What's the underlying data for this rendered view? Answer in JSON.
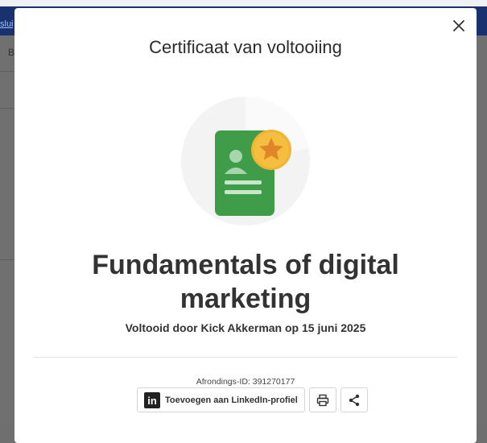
{
  "background": {
    "link_fragment": "slui"
  },
  "modal": {
    "title": "Certificaat van voltooiing",
    "course_title": "Fundamentals of digital marketing",
    "completed_text": "Voltooid door Kick Akkerman op 15 juni 2025",
    "completion_id_text": "Afrondings-ID: 391270177",
    "actions": {
      "linkedin_label": "Toevoegen aan LinkedIn-profiel"
    },
    "icons": {
      "close": "close-icon",
      "badge": "certificate-badge-icon",
      "linkedin": "linkedin-icon",
      "print": "print-icon",
      "share": "share-icon"
    }
  },
  "colors": {
    "badge_green": "#3f9d4a",
    "badge_star": "#f2b233",
    "overlay": "#707070",
    "header_blue": "#1a3170"
  }
}
